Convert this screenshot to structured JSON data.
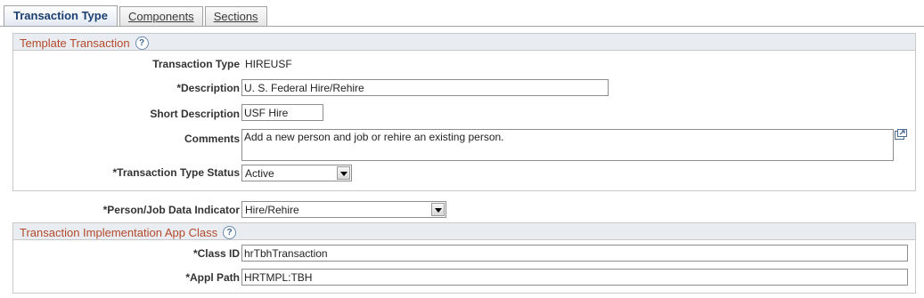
{
  "tabs": [
    {
      "label": "Transaction Type",
      "active": true
    },
    {
      "label": "Components",
      "active": false
    },
    {
      "label": "Sections",
      "active": false
    }
  ],
  "template_transaction": {
    "title": "Template Transaction",
    "help_icon": "question-mark-icon",
    "transaction_type": {
      "label": "Transaction Type",
      "value": "HIREUSF"
    },
    "description": {
      "label": "*Description",
      "value": "U. S. Federal Hire/Rehire"
    },
    "short_description": {
      "label": "Short Description",
      "value": "USF Hire"
    },
    "comments": {
      "label": "Comments",
      "value": "Add a new person and job or rehire an existing person.",
      "expand_icon": "expand-textarea-icon"
    },
    "status": {
      "label": "*Transaction Type Status",
      "value": "Active"
    }
  },
  "person_job_indicator": {
    "label": "*Person/Job Data Indicator",
    "value": "Hire/Rehire"
  },
  "implementation": {
    "title": "Transaction Implementation App Class",
    "help_icon": "question-mark-icon",
    "class_id": {
      "label": "*Class ID",
      "value": "hrTbhTransaction"
    },
    "appl_path": {
      "label": "*Appl Path",
      "value": "HRTMPL:TBH"
    }
  },
  "colors": {
    "group_title": "#b4492b",
    "group_header_bg": "#e9ecf1",
    "active_tab_text": "#1c3f72"
  }
}
